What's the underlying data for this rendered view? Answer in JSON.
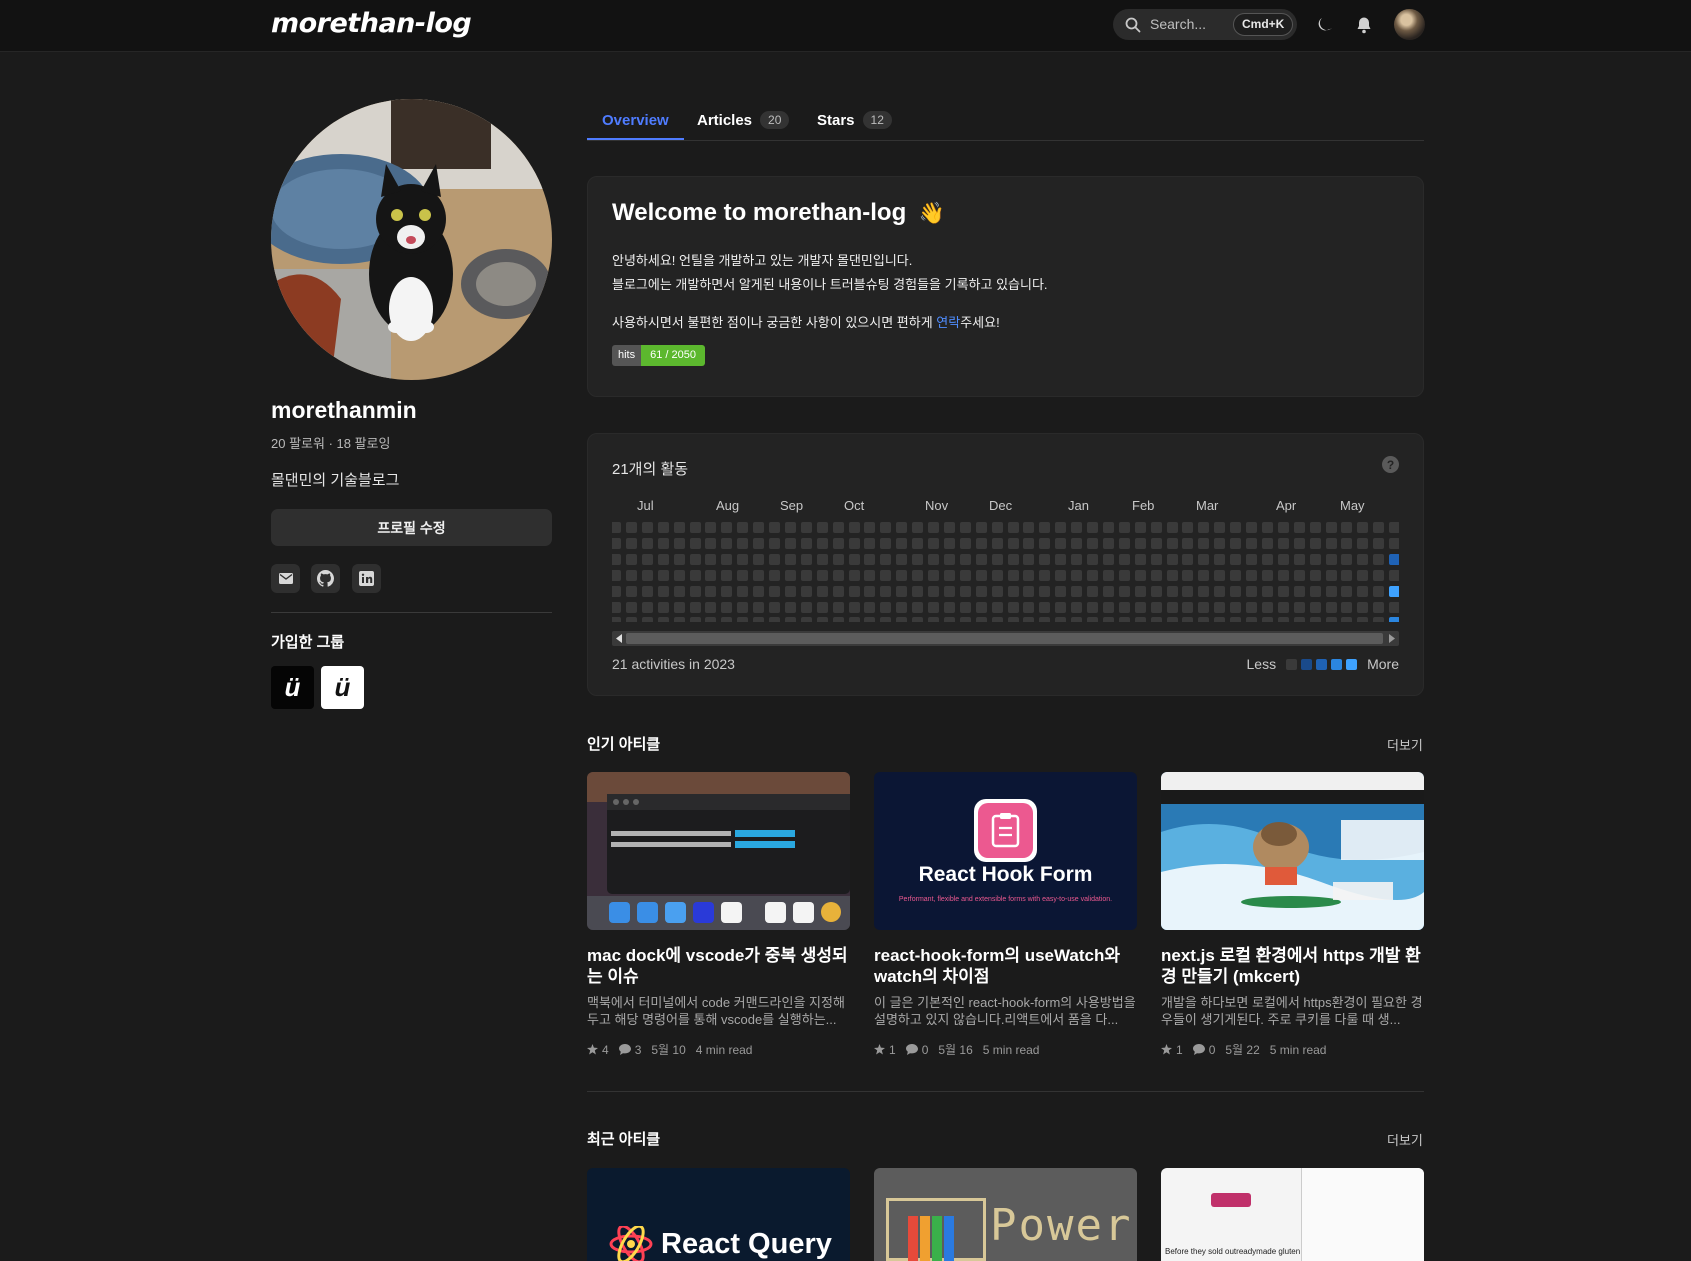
{
  "header": {
    "logo": "morethan-log",
    "search_placeholder": "Search...",
    "search_shortcut": "Cmd+K"
  },
  "profile": {
    "username": "morethanmin",
    "follow_text": "20 팔로워 · 18 팔로잉",
    "bio": "몰댄민의 기술블로그",
    "edit_button": "프로필 수정",
    "groups_title": "가입한 그룹",
    "groups": [
      {
        "letter": "ü",
        "theme": "dark"
      },
      {
        "letter": "ü",
        "theme": "light"
      }
    ]
  },
  "tabs": [
    {
      "label": "Overview",
      "count": "",
      "active": true
    },
    {
      "label": "Articles",
      "count": "20",
      "active": false
    },
    {
      "label": "Stars",
      "count": "12",
      "active": false
    }
  ],
  "welcome": {
    "title": "Welcome to morethan-log",
    "emoji": "👋",
    "line1": "안녕하세요! 언틸을 개발하고 있는 개발자 몰댄민입니다.",
    "line2": "블로그에는 개발하면서 알게된 내용이나 트러블슈팅 경험들을 기록하고 있습니다.",
    "line3_pre": "사용하시면서 불편한 점이나 궁금한 사항이 있으시면 편하게 ",
    "line3_link": "연락",
    "line3_post": "주세요!",
    "hits_label": "hits",
    "hits_value": "61 / 2050"
  },
  "activity": {
    "title": "21개의 활동",
    "months": [
      "Jul",
      "Aug",
      "Sep",
      "Oct",
      "Nov",
      "Dec",
      "Jan",
      "Feb",
      "Mar",
      "Apr",
      "May"
    ],
    "footer": "21 activities in 2023",
    "legend_less": "Less",
    "legend_more": "More",
    "colors": [
      "#3a3a3a",
      "#1a4a8a",
      "#1f62b5",
      "#2b86e0",
      "#3ea2ff"
    ]
  },
  "popular": {
    "title": "인기 아티클",
    "more": "더보기",
    "articles": [
      {
        "title": "mac dock에 vscode가 중복 생성되는 이슈",
        "desc": "맥북에서 터미널에서 code 커맨드라인을 지정해두고 해당 명령어를 통해 vscode를 실행하는...",
        "stars": "4",
        "comments": "3",
        "date": "5월 10",
        "read": "4 min read"
      },
      {
        "title": "react-hook-form의 useWatch와 watch의 차이점",
        "desc": "이 글은 기본적인 react-hook-form의 사용방법을 설명하고 있지 않습니다.리액트에서 폼을 다...",
        "stars": "1",
        "comments": "0",
        "date": "5월 16",
        "read": "5 min read",
        "thumb_title": "React Hook Form",
        "thumb_sub": "Performant, flexible and extensible forms with easy-to-use validation."
      },
      {
        "title": "next.js 로컬 환경에서 https 개발 환경 만들기 (mkcert)",
        "desc": "개발을 하다보면 로컬에서 https환경이 필요한 경우들이 생기게된다. 주로 쿠키를 다룰 때 생...",
        "stars": "1",
        "comments": "0",
        "date": "5월 22",
        "read": "5 min read"
      }
    ]
  },
  "recent": {
    "title": "최근 아티클",
    "more": "더보기",
    "thumbs": [
      {
        "label": "React Query"
      },
      {
        "label": "Power"
      },
      {
        "label": "Before they sold outreadymade gluten"
      }
    ]
  }
}
